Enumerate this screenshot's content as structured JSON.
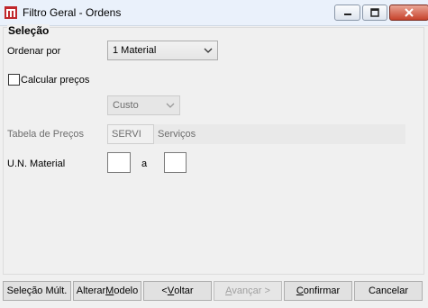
{
  "window": {
    "title": "Filtro Geral - Ordens"
  },
  "group": {
    "title": "Seleção"
  },
  "ordenar": {
    "label": "Ordenar por",
    "value": "1 Material"
  },
  "calcular": {
    "label": "Calcular preços",
    "checked": false
  },
  "custo": {
    "value": "Custo"
  },
  "tabela": {
    "label": "Tabela de Preços",
    "code": "SERVI",
    "description": "Serviços"
  },
  "un": {
    "label": "U.N. Material",
    "from": "",
    "to": "",
    "separator": "a"
  },
  "buttons": {
    "selecao": "Seleção Múlt.",
    "alterar_pre": "Alterar ",
    "alterar_acc": "M",
    "alterar_post": "odelo",
    "voltar_pre": "< ",
    "voltar_acc": "V",
    "voltar_post": "oltar",
    "avancar_pre": "",
    "avancar_acc": "A",
    "avancar_post": "vançar >",
    "confirmar_pre": "",
    "confirmar_acc": "C",
    "confirmar_post": "onfirmar",
    "cancelar": "Cancelar"
  }
}
